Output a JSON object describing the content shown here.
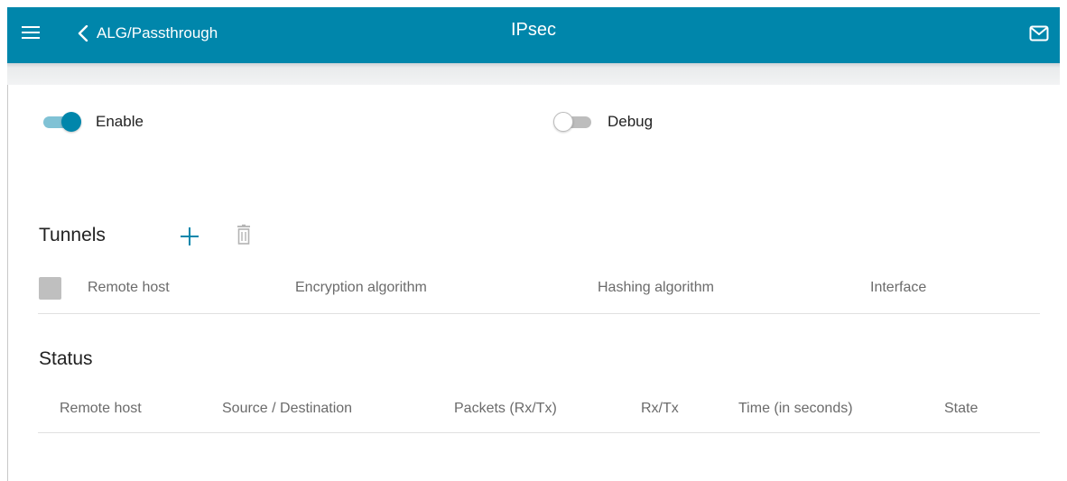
{
  "header": {
    "back_label": "ALG/Passthrough",
    "title": "IPsec",
    "menu_icon": "hamburger-menu-icon",
    "back_icon": "chevron-left-icon",
    "mail_icon": "envelope-icon"
  },
  "toggles": {
    "enable": {
      "label": "Enable",
      "state": "on"
    },
    "debug": {
      "label": "Debug",
      "state": "off"
    }
  },
  "tunnels": {
    "title": "Tunnels",
    "add_icon": "plus-icon",
    "delete_icon": "trash-icon",
    "columns": [
      "Remote host",
      "Encryption algorithm",
      "Hashing algorithm",
      "Interface"
    ]
  },
  "status": {
    "title": "Status",
    "columns": [
      "Remote host",
      "Source / Destination",
      "Packets (Rx/Tx)",
      "Rx/Tx",
      "Time (in seconds)",
      "State"
    ]
  },
  "colors": {
    "accent": "#0086ab",
    "toggle_track_on": "#80c2d5",
    "checkbox": "#bfbfbf",
    "muted_text": "#6b6b6b"
  }
}
